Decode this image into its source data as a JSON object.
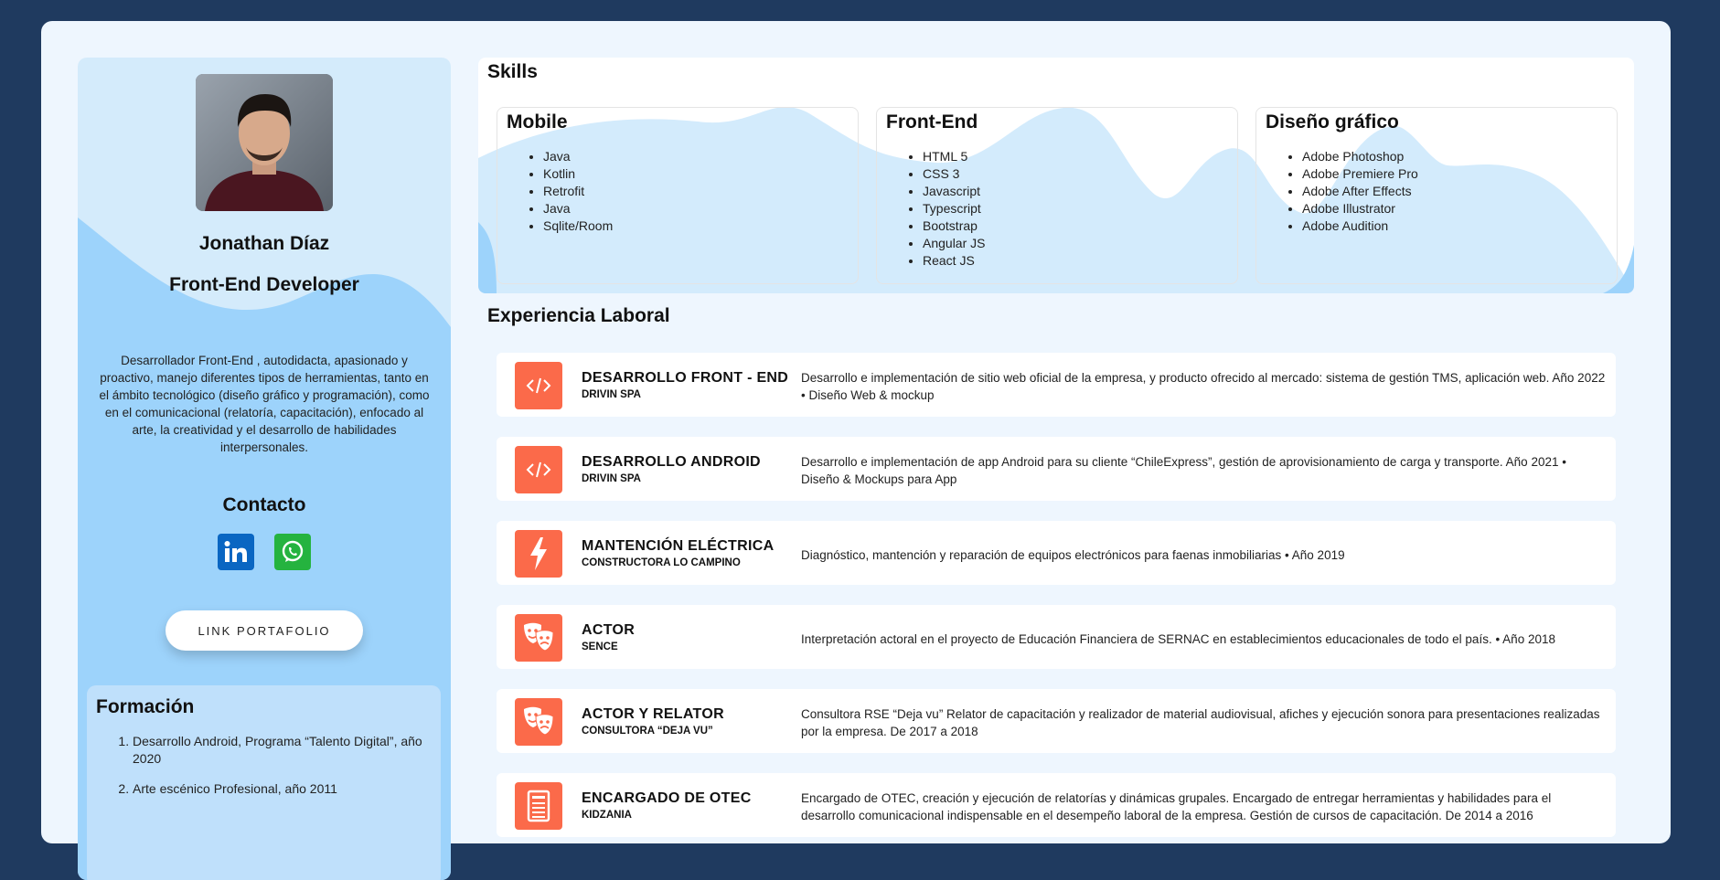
{
  "profile": {
    "name": "Jonathan Díaz",
    "role": "Front-End Developer",
    "bio": "Desarrollador Front-End , autodidacta, apasionado y proactivo, manejo diferentes tipos de herramientas, tanto en el ámbito tecnológico (diseño gráfico y programación), como en el comunicacional (relatoría, capacitación), enfocado al arte, la creatividad y el desarrollo de habilidades interpersonales."
  },
  "contact": {
    "title": "Contacto",
    "linkedin_icon": "linkedin-icon",
    "whatsapp_icon": "whatsapp-icon",
    "portfolio_label": "LINK PORTAFOLIO"
  },
  "formacion": {
    "title": "Formación",
    "items": [
      "Desarrollo Android, Programa “Talento Digital”, año 2020",
      "Arte escénico Profesional, año 2011"
    ]
  },
  "skills": {
    "title": "Skills",
    "groups": [
      {
        "title": "Mobile",
        "items": [
          "Java",
          "Kotlin",
          "Retrofit",
          "Java",
          "Sqlite/Room"
        ]
      },
      {
        "title": "Front-End",
        "items": [
          "HTML 5",
          "CSS 3",
          "Javascript",
          "Typescript",
          "Bootstrap",
          "Angular JS",
          "React JS"
        ]
      },
      {
        "title": "Diseño gráfico",
        "items": [
          "Adobe Photoshop",
          "Adobe Premiere Pro",
          "Adobe After Effects",
          "Adobe Illustrator",
          "Adobe Audition"
        ]
      }
    ]
  },
  "experience": {
    "title": "Experiencia Laboral",
    "items": [
      {
        "icon": "code-icon",
        "role": "DESARROLLO FRONT - END",
        "company": "DRIVIN SPA",
        "description": "Desarrollo e implementación de sitio web oficial de la empresa, y producto ofrecido al mercado: sistema de gestión TMS, aplicación web. Año 2022 • Diseño Web & mockup"
      },
      {
        "icon": "code-icon",
        "role": "DESARROLLO ANDROID",
        "company": "DRIVIN SPA",
        "description": "Desarrollo e implementación de app Android para su cliente “ChileExpress”, gestión de aprovisionamiento de carga y transporte. Año 2021 • Diseño & Mockups para App"
      },
      {
        "icon": "lightning-icon",
        "role": "MANTENCIÓN ELÉCTRICA",
        "company": "CONSTRUCTORA LO CAMPINO",
        "description": "Diagnóstico, mantención y reparación de equipos electrónicos para faenas inmobiliarias • Año 2019"
      },
      {
        "icon": "theater-masks-icon",
        "role": "ACTOR",
        "company": "SENCE",
        "description": "Interpretación actoral en el proyecto de Educación Financiera de SERNAC en establecimientos educacionales de todo el país. • Año 2018"
      },
      {
        "icon": "theater-masks-icon",
        "role": "ACTOR Y RELATOR",
        "company": "CONSULTORA “DEJA VU”",
        "description": "Consultora RSE “Deja vu” Relator de capacitación y realizador de material audiovisual, afiches y ejecución sonora para presentaciones realizadas por la empresa. De 2017 a 2018"
      },
      {
        "icon": "document-icon",
        "role": "ENCARGADO DE OTEC",
        "company": "KIDZANIA",
        "description": "Encargado de OTEC, creación y ejecución de relatorías y dinámicas grupales. Encargado de entregar herramientas y habilidades para el desarrollo comunicacional indispensable en el desempeño laboral de la empresa. Gestión de cursos de capacitación. De 2014 a 2016"
      }
    ]
  },
  "colors": {
    "page_bg": "#1f3a5f",
    "card_bg": "#eef6fe",
    "sidebar_light": "#d4ebfb",
    "sidebar_wave": "#9dd3fb",
    "accent": "#fb6a4a",
    "skills_wave": "#d3ebfc"
  }
}
